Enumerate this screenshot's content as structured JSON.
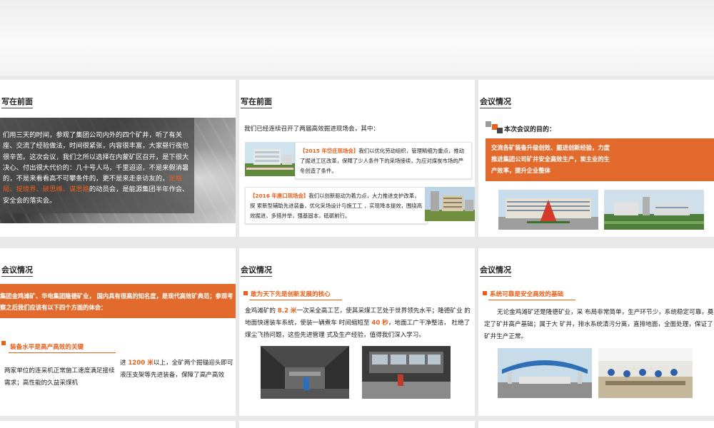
{
  "slides": {
    "s1": {
      "title": "写在前面",
      "body_1": "们用三天的时间，参观了集团公司内外的四个矿井，听了有关座、交流了经验做法，时间很紧张，内容很丰富，大家昼行夜也很辛苦。这次会议，我们之所以选择在内蒙矿区召开，是下很大决心、付出很大代价的：几十号人马，千里迢迢，不是来假消暑的，不是来看看高不可攀条件的，更不是来走亲访友的，",
      "body_highlight": "定格局、提境界、破思维、谋思路",
      "body_2": "的动员会，是能源集团半年作会、安全会的落实会。"
    },
    "s2": {
      "title": "写在前面",
      "lead": "我们已经连续召开了两届高效掘进现场会，其中：",
      "box1_tag": "【2015 年岱庄现场会】",
      "box1_text": "我们以优化劳动组织，管理精细为重点，推动了掘进工区改革，保障了少人条件下的采场接续，为应对煤炭市场的严冬创造了条件。",
      "box2_tag": "【2016 年唐口现场会】",
      "box2_text": "我们以创新驱动为着力点，大力推进支护改革，探 索新型辅助先进装备，优化采场设计与施工工 ，实现降本提效，围绕高 效掘进，多措并举，强基固本，砥砺前行。"
    },
    "s3": {
      "title": "会议情况",
      "purpose_heading": "本次会议的目的：",
      "bar_text": "交流各矿装备升级创效、掘进创新经验，力度推进集团公司矿井安全高效生产，炭主业的生产效率，提升企业整体"
    },
    "s4": {
      "title": "会议情况",
      "bar_text": "集团金鸡滩矿、华电集团隆德矿业，    国内具有很高的知名度，是现代高效矿典范；参观考察之后我们应该有以下四个方面的体会：",
      "sub_heading": "装备水平是高产高效的关键",
      "left_text": "两家单位的连采机正常施工速度满足接续需求；高性能的久益采煤机",
      "right_pre": "进 ",
      "right_hl": "1200 米",
      "right_post": "以上，全矿两个掘锚迎头即可 液压支架等先进装备，保障了高产高效"
    },
    "s5": {
      "title": "会议情况",
      "sub_heading": "敢为天下先是创新发展的核心",
      "t1": "金鸡滩矿的 ",
      "hl1": "8.2 米",
      "t2": "一次采全高工艺，使其采煤工艺处于世界领先水平；隆德矿业 的地面快速装车系统，使装一辆煮车 时间缩短至 ",
      "hl2": "40 秒",
      "t3": "，地面工广干净整洁，  杜绝了煤尘飞扬问题，这些先进管理 式及生产经验，值得我们深入学习。"
    },
    "s6": {
      "title": "会议情况",
      "sub_heading": "系统可靠是安全高效的基础",
      "body": "无论金鸡滩矿还是隆德矿业，采    布局非常简单，生产环节少，系统稳定可靠，奠定了矿井高产基础；属于大 矿井，排水系统清污分离，直排地面，全面处理，保证了矿井生产正常。"
    }
  },
  "colors": {
    "accent": "#e8601c",
    "bar": "#e26a2c",
    "background": "#e9e9e9"
  }
}
